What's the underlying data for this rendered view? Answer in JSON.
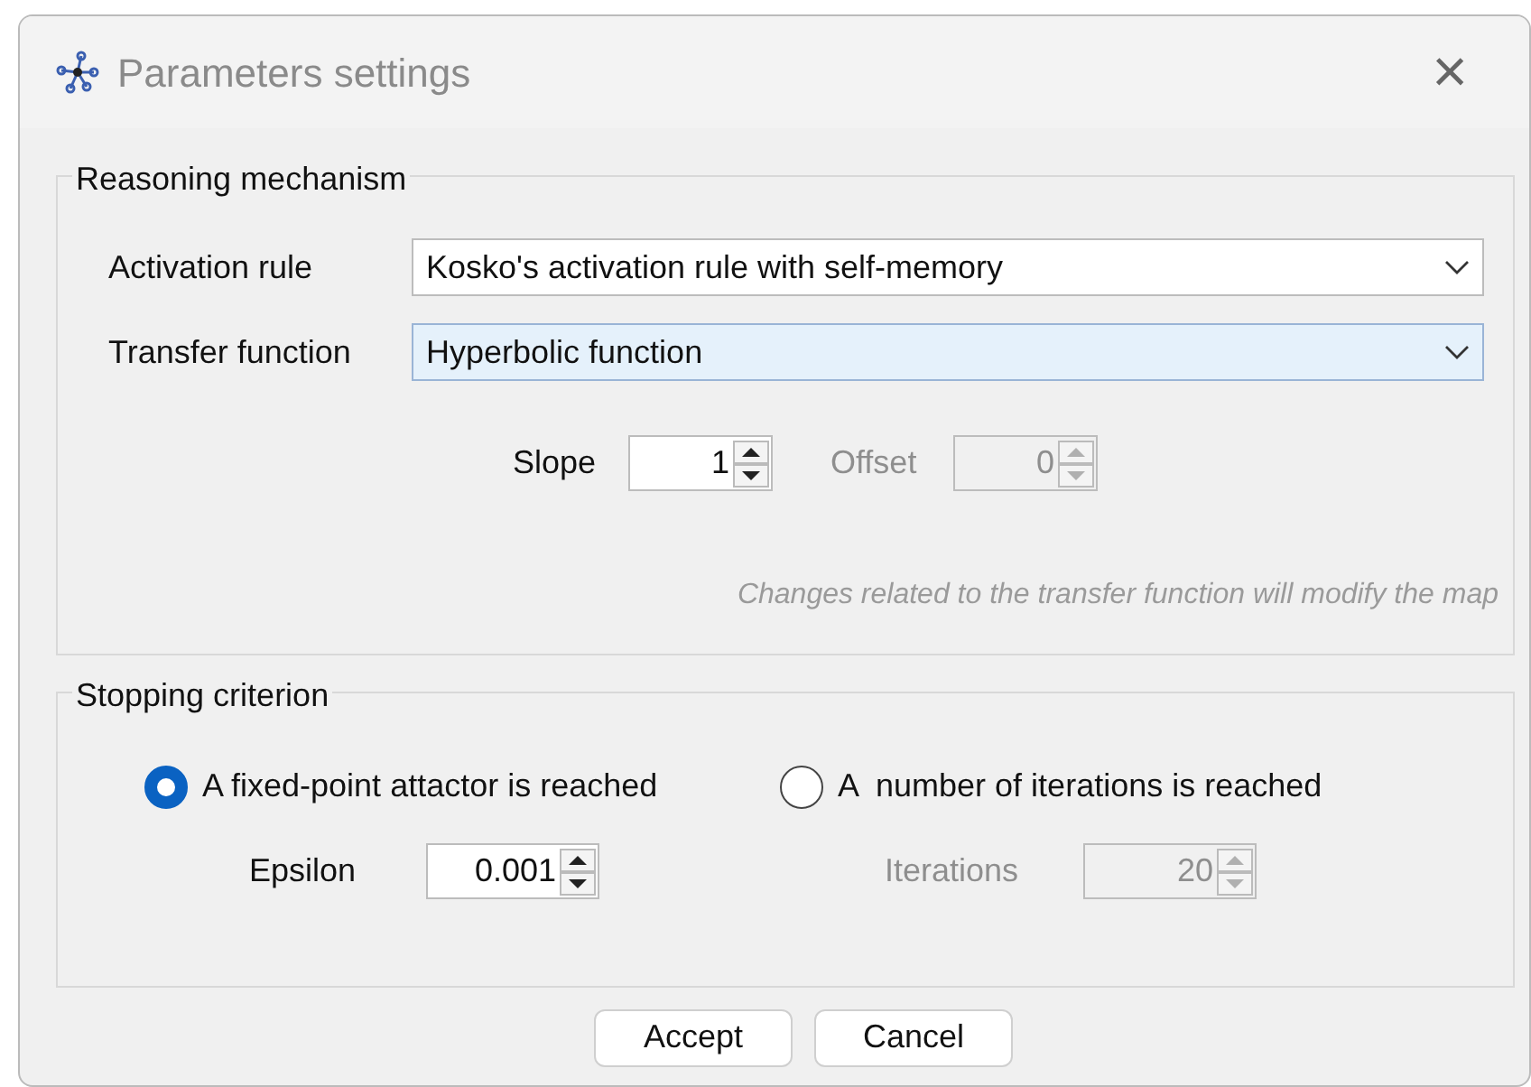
{
  "window": {
    "title": "Parameters settings",
    "close": "×"
  },
  "reasoning": {
    "legend": "Reasoning mechanism",
    "dropdowns": [
      {
        "label": "Activation rule",
        "value": "Kosko's activation rule with self-memory",
        "focused": false
      },
      {
        "label": "Transfer function",
        "value": "Hyperbolic function",
        "focused": true
      }
    ],
    "spinners": [
      {
        "label": "Slope",
        "value": "1",
        "disabled": false
      },
      {
        "label": "Offset",
        "value": "0",
        "disabled": true
      }
    ],
    "note": "Changes related to the transfer function will modify the map"
  },
  "stopping": {
    "legend": "Stopping criterion",
    "options": [
      {
        "label": "A fixed-point attactor is reached",
        "selected": true,
        "spinner": {
          "label": "Epsilon",
          "value": "0.001",
          "disabled": false
        }
      },
      {
        "label": "A  number of iterations is reached",
        "selected": false,
        "spinner": {
          "label": "Iterations",
          "value": "20",
          "disabled": true
        }
      }
    ]
  },
  "buttons": [
    "Accept",
    "Cancel"
  ]
}
